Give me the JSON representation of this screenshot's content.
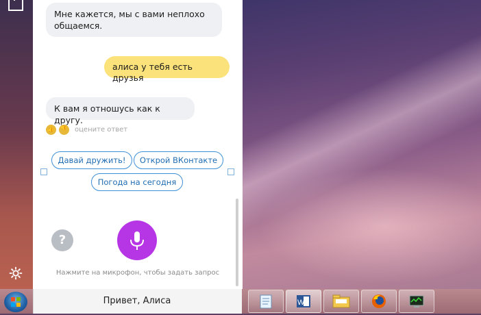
{
  "chat": {
    "messages": [
      {
        "from": "alice",
        "text": "Мне кажется, мы с вами неплохо общаемся."
      },
      {
        "from": "user",
        "text": "алиса у тебя есть друзья"
      },
      {
        "from": "alice",
        "text": "К вам я отношусь как к другу."
      }
    ],
    "rate_label": "оцените ответ"
  },
  "suggestions": [
    "Давай дружить!",
    "Открой ВКонтакте",
    "Погода на сегодня"
  ],
  "controls": {
    "help_symbol": "?",
    "hint": "Нажмите на микрофон, чтобы задать запрос"
  },
  "taskbar": {
    "search_text": "Привет, Алиса",
    "apps": [
      "notepad-icon",
      "word-icon",
      "file-explorer-icon",
      "firefox-icon",
      "task-manager-icon"
    ]
  },
  "colors": {
    "user_bubble": "#fbe27a",
    "alice_bubble": "#eef0f3",
    "mic_button": "#b636e6",
    "chip_border": "#3d8fd6"
  }
}
